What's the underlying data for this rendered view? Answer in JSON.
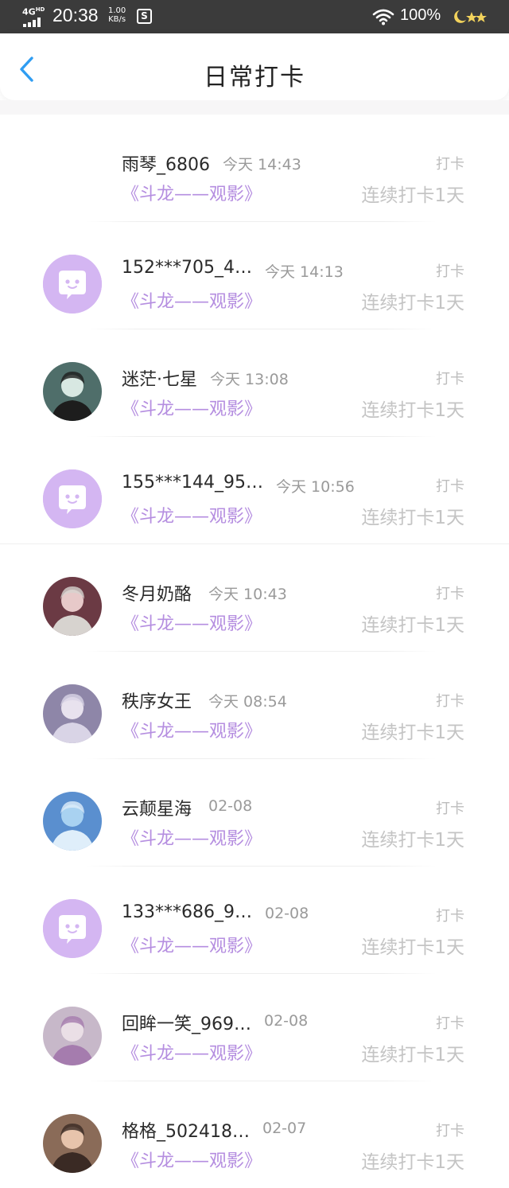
{
  "status_bar": {
    "network": "4G",
    "network_sup": "HD",
    "time": "20:38",
    "speed_value": "1.00",
    "speed_unit": "KB/s",
    "calendar_glyph": "S",
    "battery": "100%",
    "icons": [
      "signal-icon",
      "calendar-icon",
      "wifi-icon",
      "moon-stars-icon"
    ]
  },
  "header": {
    "title": "日常打卡",
    "back_icon": "chevron-left-icon",
    "accent_color": "#2f9df2"
  },
  "colors": {
    "book_title": "#b58ee0",
    "default_avatar": "#d4b6f2",
    "name": "#2a2a2a",
    "meta": "#9a9a9a"
  },
  "checkins": [
    {
      "name": "雨琴_6806",
      "time": "今天 14:43",
      "book": "《斗龙——观影》",
      "action": "打卡",
      "streak": "连续打卡1天",
      "avatar": "none"
    },
    {
      "name": "152***705_4…",
      "time": "今天 14:13",
      "book": "《斗龙——观影》",
      "action": "打卡",
      "streak": "连续打卡1天",
      "avatar": "default"
    },
    {
      "name": "迷茫·七星",
      "time": "今天 13:08",
      "book": "《斗龙——观影》",
      "action": "打卡",
      "streak": "连续打卡1天",
      "avatar": "photo"
    },
    {
      "name": "155***144_95…",
      "time": "今天 10:56",
      "book": "《斗龙——观影》",
      "action": "打卡",
      "streak": "连续打卡1天",
      "avatar": "default"
    },
    {
      "name": "冬月奶酪",
      "time": "今天 10:43",
      "book": "《斗龙——观影》",
      "action": "打卡",
      "streak": "连续打卡1天",
      "avatar": "photo"
    },
    {
      "name": "秩序女王",
      "time": "今天 08:54",
      "book": "《斗龙——观影》",
      "action": "打卡",
      "streak": "连续打卡1天",
      "avatar": "photo"
    },
    {
      "name": "云颠星海",
      "time": "02-08",
      "book": "《斗龙——观影》",
      "action": "打卡",
      "streak": "连续打卡1天",
      "avatar": "photo"
    },
    {
      "name": "133***686_9…",
      "time": "02-08",
      "book": "《斗龙——观影》",
      "action": "打卡",
      "streak": "连续打卡1天",
      "avatar": "default"
    },
    {
      "name": "回眸一笑_969…",
      "time": "02-08",
      "book": "《斗龙——观影》",
      "action": "打卡",
      "streak": "连续打卡1天",
      "avatar": "photo"
    },
    {
      "name": "格格_502418…",
      "time": "02-07",
      "book": "《斗龙——观影》",
      "action": "打卡",
      "streak": "连续打卡1天",
      "avatar": "photo"
    }
  ]
}
